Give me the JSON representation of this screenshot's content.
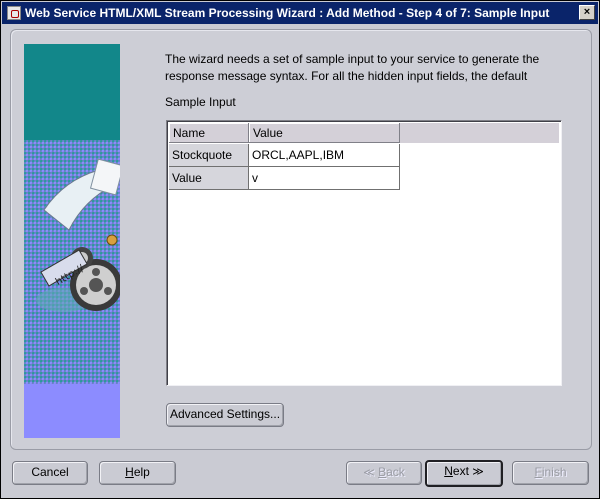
{
  "window": {
    "title": "Web Service HTML/XML Stream Processing Wizard : Add Method - Step 4 of 7: Sample Input",
    "close_label": "×"
  },
  "content": {
    "intro_line1": "The wizard needs a set of sample input to your service to generate the",
    "intro_line2": "response message syntax. For all the hidden input fields, the default",
    "sample_input_label": "Sample Input"
  },
  "table": {
    "columns": [
      "Name",
      "Value"
    ],
    "rows": [
      {
        "name": "Stockquote",
        "value": "ORCL,AAPL,IBM"
      },
      {
        "name": "Value",
        "value": "v"
      }
    ]
  },
  "buttons": {
    "advanced_settings": "Advanced Settings...",
    "cancel": "Cancel",
    "help_prefix": "",
    "help_key": "H",
    "help_rest": "elp",
    "back_chevron": "≪",
    "back_key": "B",
    "back_rest": "ack",
    "next_key": "N",
    "next_rest": "ext",
    "next_chevron": "≫",
    "finish_key": "F",
    "finish_rest": "inish"
  },
  "state": {
    "back_enabled": false,
    "next_enabled": true,
    "finish_enabled": false
  },
  "icons": [
    "app-icon",
    "close-icon",
    "wizard-illustration"
  ],
  "colors": {
    "titlebar": "#0a246a",
    "image_teal": "#12878a",
    "image_violet": "#8c8cff"
  }
}
